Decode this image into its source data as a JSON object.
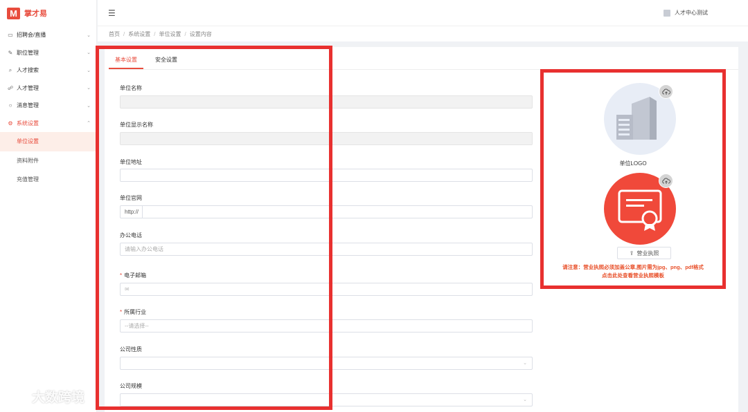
{
  "app": {
    "logo_text": "掌才易",
    "logo_mark": "M"
  },
  "sidebar": {
    "items": [
      {
        "label": "招聘会/直播",
        "icon": "calendar-icon",
        "glyph": "▭"
      },
      {
        "label": "职位管理",
        "icon": "edit-icon",
        "glyph": "✎"
      },
      {
        "label": "人才搜索",
        "icon": "search-icon",
        "glyph": "⌕"
      },
      {
        "label": "人才管理",
        "icon": "users-icon",
        "glyph": "ꀀ"
      },
      {
        "label": "消息管理",
        "icon": "message-icon",
        "glyph": "○"
      },
      {
        "label": "系统设置",
        "icon": "settings-icon",
        "glyph": "⚙"
      }
    ],
    "sub_items": [
      {
        "label": "单位设置"
      },
      {
        "label": "资料附件"
      },
      {
        "label": "充值管理"
      }
    ]
  },
  "header": {
    "user_name": "人才中心测试",
    "menu_icon": "menu-fold-icon"
  },
  "breadcrumb": [
    "首页",
    "系统设置",
    "单位设置",
    "设置内容"
  ],
  "tabs": [
    "基本设置",
    "安全设置"
  ],
  "form": {
    "unit_name": {
      "label": "单位名称",
      "value": ""
    },
    "display_name": {
      "label": "单位显示名称",
      "value": ""
    },
    "address": {
      "label": "单位地址",
      "value": ""
    },
    "website": {
      "label": "单位官网",
      "prefix": "http://",
      "value": ""
    },
    "office_phone": {
      "label": "办公电话",
      "placeholder": "请输入办公电话"
    },
    "email": {
      "label": "电子邮箱",
      "required": "*"
    },
    "industry": {
      "label": "所属行业",
      "required": "*",
      "placeholder": "--请选择--"
    },
    "nature": {
      "label": "公司性质"
    },
    "scale": {
      "label": "公司规模"
    }
  },
  "right_panel": {
    "logo_caption": "单位LOGO",
    "license_button": "营业执照",
    "notice_line1": "请注意：营业执照必须加盖公章,图片需为jpg、png、pdf格式",
    "notice_line2": "点击此处查看营业执照模板"
  },
  "watermark": {
    "text": "大数跨境"
  },
  "colors": {
    "accent": "#e84c3d",
    "annotation_red": "#e8302f",
    "license_bg": "#f0493a",
    "logo_bg": "#e8edf6"
  }
}
